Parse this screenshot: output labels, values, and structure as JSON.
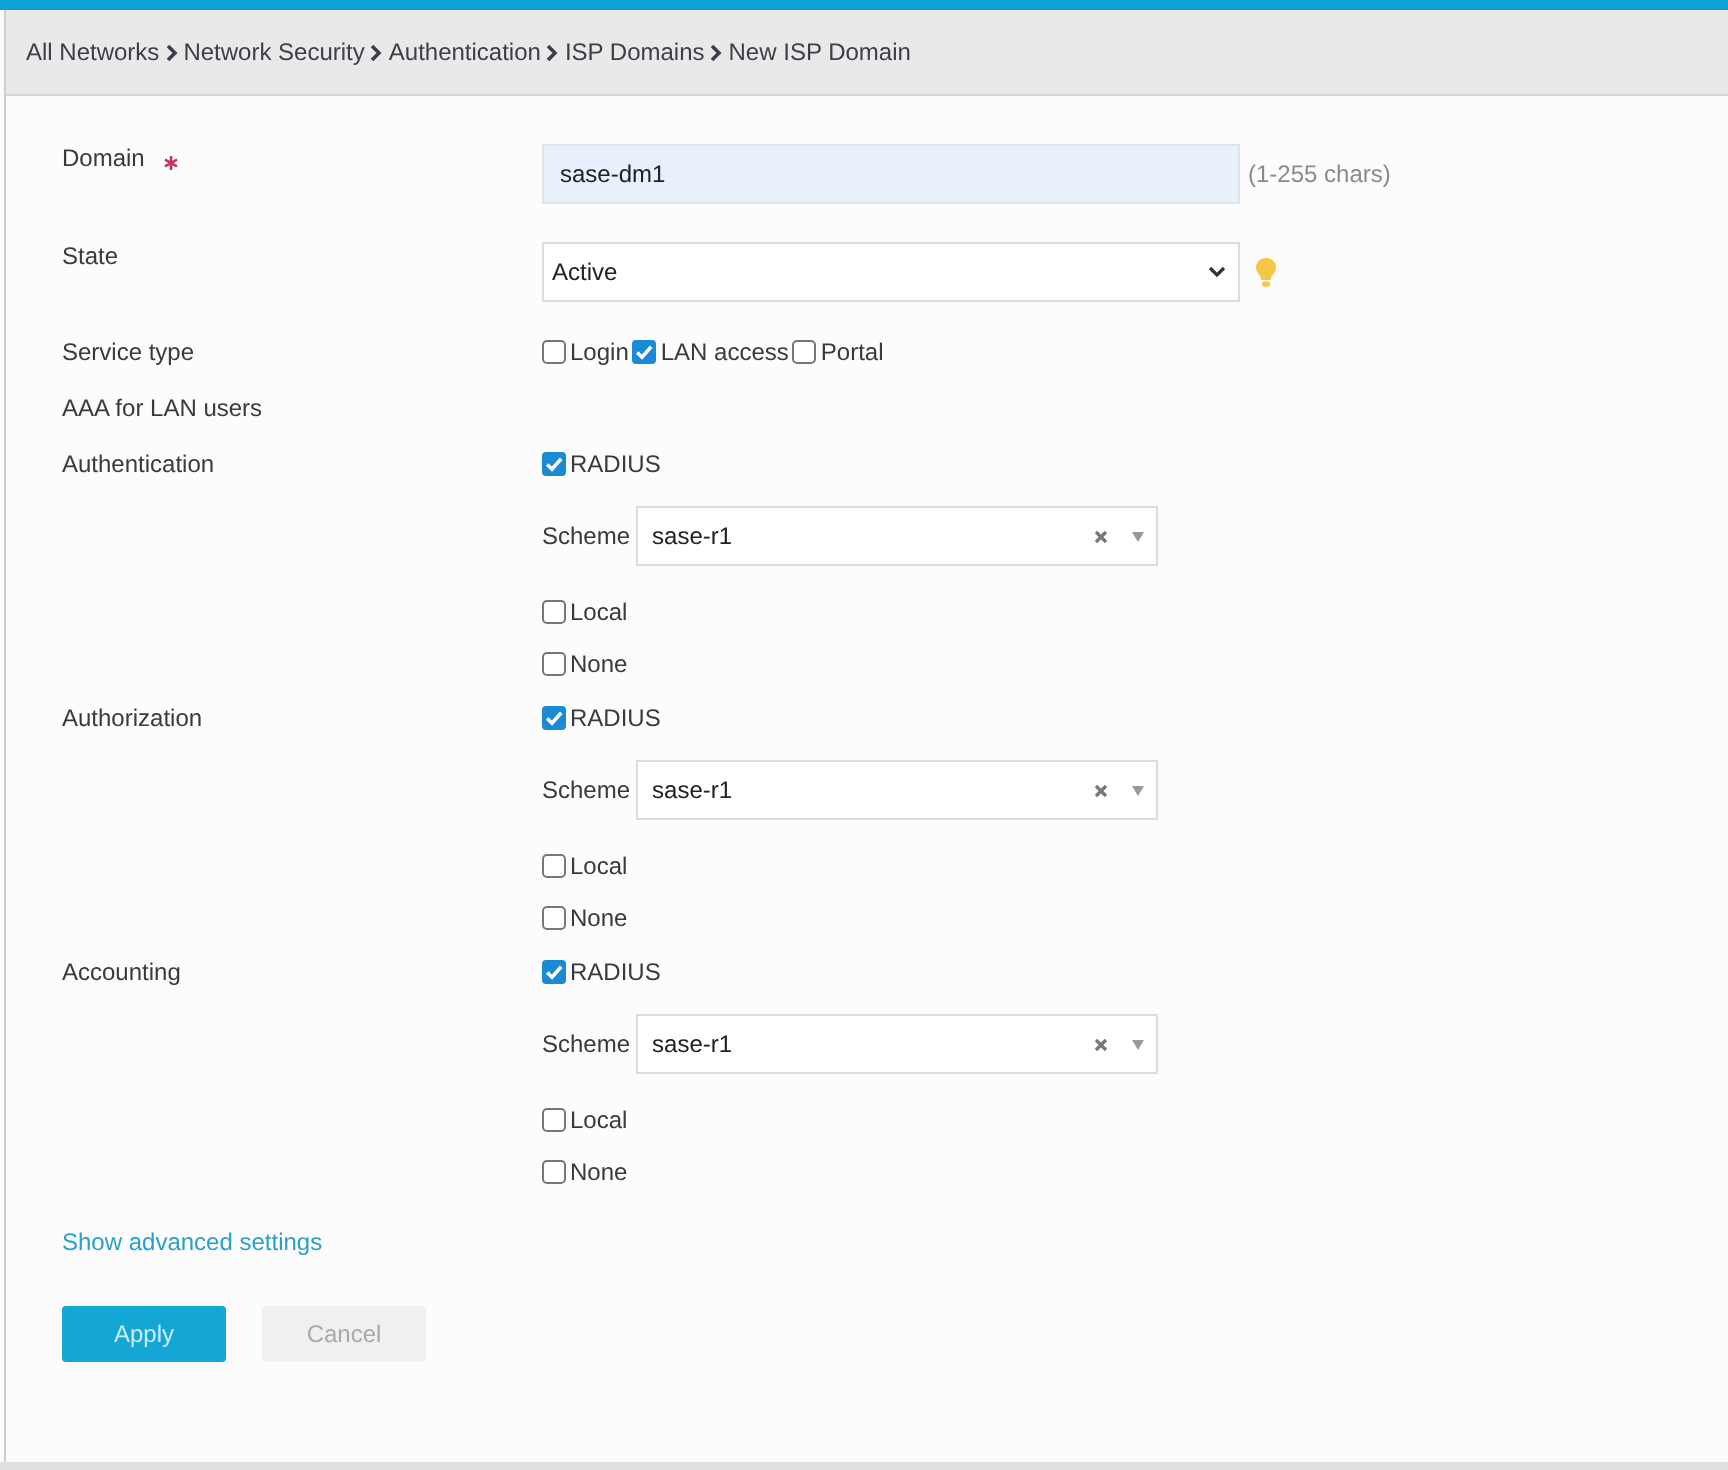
{
  "breadcrumb": [
    "All Networks",
    "Network Security",
    "Authentication",
    "ISP Domains",
    "New ISP Domain"
  ],
  "form": {
    "domain": {
      "label": "Domain",
      "required": true,
      "value": "sase-dm1",
      "hint": "(1-255 chars)"
    },
    "state": {
      "label": "State",
      "value": "Active"
    },
    "service_type": {
      "label": "Service type",
      "options": [
        {
          "label": "Login",
          "checked": false
        },
        {
          "label": "LAN access",
          "checked": true
        },
        {
          "label": "Portal",
          "checked": false
        }
      ]
    },
    "aaa_title": "AAA for LAN users",
    "aaa": [
      {
        "label": "Authentication",
        "methods": [
          {
            "label": "RADIUS",
            "checked": true,
            "scheme": {
              "label": "Scheme",
              "value": "sase-r1"
            }
          },
          {
            "label": "Local",
            "checked": false
          },
          {
            "label": "None",
            "checked": false
          }
        ]
      },
      {
        "label": "Authorization",
        "methods": [
          {
            "label": "RADIUS",
            "checked": true,
            "scheme": {
              "label": "Scheme",
              "value": "sase-r1"
            }
          },
          {
            "label": "Local",
            "checked": false
          },
          {
            "label": "None",
            "checked": false
          }
        ]
      },
      {
        "label": "Accounting",
        "methods": [
          {
            "label": "RADIUS",
            "checked": true,
            "scheme": {
              "label": "Scheme",
              "value": "sase-r1"
            }
          },
          {
            "label": "Local",
            "checked": false
          },
          {
            "label": "None",
            "checked": false
          }
        ]
      }
    ]
  },
  "advanced_link": "Show advanced settings",
  "buttons": [
    {
      "label": "Apply",
      "kind": "primary"
    },
    {
      "label": "Cancel",
      "kind": "secondary"
    }
  ]
}
